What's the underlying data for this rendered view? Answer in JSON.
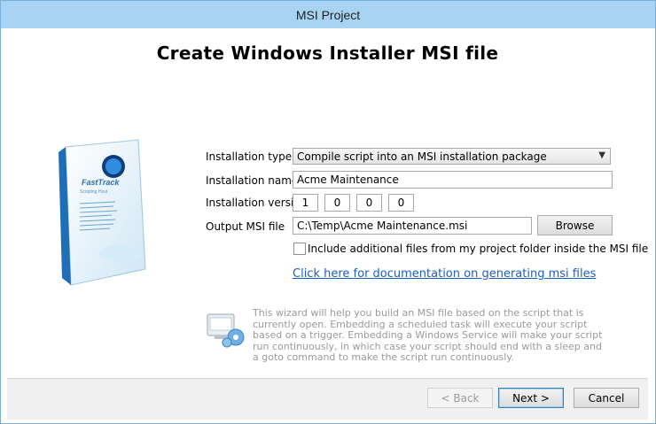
{
  "window": {
    "title": "MSI Project"
  },
  "heading": "Create Windows Installer MSI file",
  "box": {
    "brand": "FastTrack",
    "subtitle": "Scripting Host"
  },
  "form": {
    "install_type_label": "Installation type",
    "install_type_value": "Compile script into an MSI installation package",
    "install_name_label": "Installation name",
    "install_name_value": "Acme Maintenance",
    "install_version_label": "Installation version",
    "version": [
      "1",
      "0",
      "0",
      "0"
    ],
    "output_label": "Output MSI file",
    "output_value": "C:\\Temp\\Acme Maintenance.msi",
    "browse_label": "Browse",
    "include_label": "Include additional files from my project folder inside the MSI file",
    "doc_link": "Click here for documentation on generating msi files"
  },
  "info_text": "This wizard will help you build an MSI file based on the script that is currently open. Embedding a scheduled task will execute your script based on a trigger. Embedding a Windows Service will make your script run continuously, in which case your script should end with a sleep and a goto command to make the script run continuously.",
  "footer": {
    "back_label": "< Back",
    "next_label": "Next >",
    "cancel_label": "Cancel"
  }
}
